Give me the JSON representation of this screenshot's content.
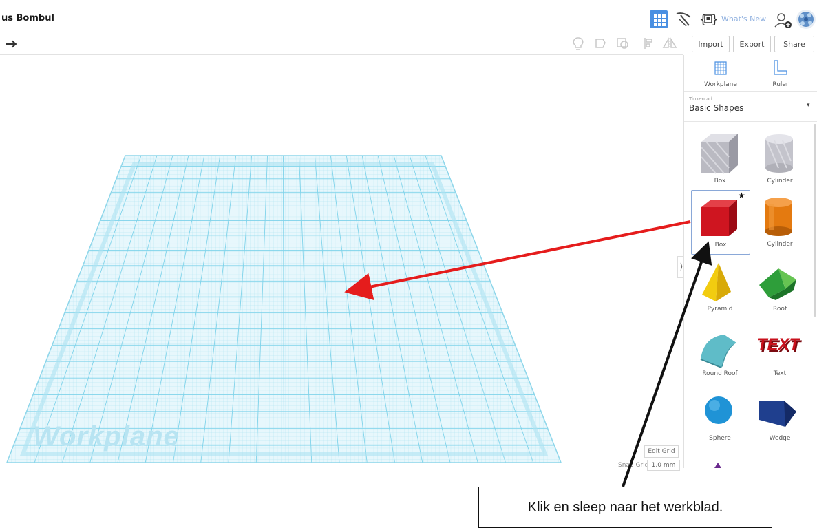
{
  "header": {
    "title": "us Bombul",
    "whats_new": "What's New"
  },
  "toolbar": {
    "import_label": "Import",
    "export_label": "Export",
    "share_label": "Share"
  },
  "panel": {
    "workplane_label": "Workplane",
    "ruler_label": "Ruler",
    "library_source": "Tinkercad",
    "library_name": "Basic Shapes",
    "shapes": [
      {
        "label": "Box",
        "color": "#b8b8c0"
      },
      {
        "label": "Cylinder",
        "color": "#c8c8d0"
      },
      {
        "label": "Box",
        "color": "#d0141e"
      },
      {
        "label": "Cylinder",
        "color": "#e87a12"
      },
      {
        "label": "Pyramid",
        "color": "#f2cc10"
      },
      {
        "label": "Roof",
        "color": "#2e9e3a"
      },
      {
        "label": "Round Roof",
        "color": "#5fbcc8"
      },
      {
        "label": "Text",
        "color": "#c8101c"
      },
      {
        "label": "Sphere",
        "color": "#1f93d6"
      },
      {
        "label": "Wedge",
        "color": "#1f3f8e"
      }
    ]
  },
  "workspace": {
    "workplane_watermark": "Workplane",
    "edit_grid_label": "Edit Grid",
    "snap_grid_label": "Snap Grid",
    "snap_grid_value": "1.0 mm"
  },
  "annotation": {
    "callout_text": "Klik en sleep naar het werkblad."
  },
  "colors": {
    "accent": "#4a90e2",
    "grid": "#7fd3ea",
    "arrow_red": "#e51c1c"
  }
}
